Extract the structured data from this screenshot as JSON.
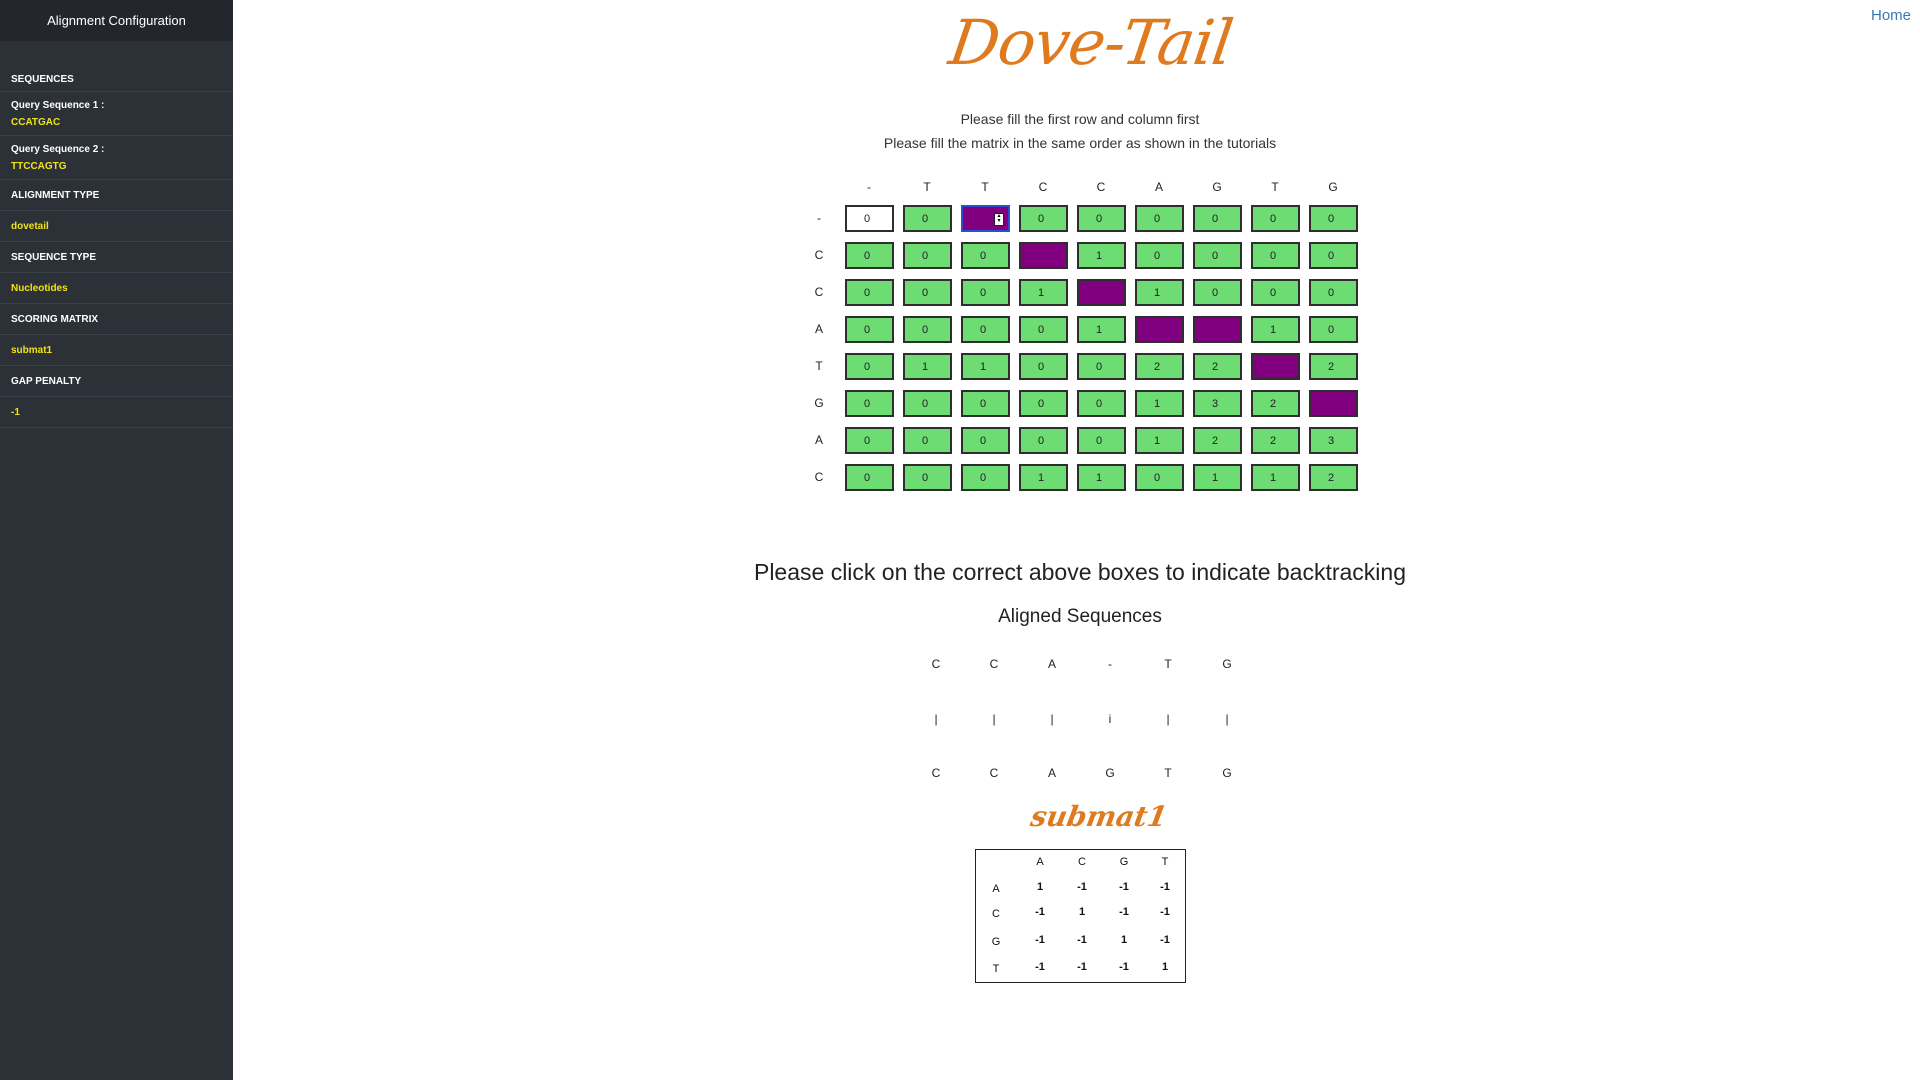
{
  "sidebar": {
    "title": "Alignment Configuration",
    "sections": {
      "sequences": "SEQUENCES",
      "query1_label": "Query Sequence 1 :",
      "query1_value": "CCATGAC",
      "query2_label": "Query Sequence 2 :",
      "query2_value": "TTCCAGTG",
      "alignment_type": "ALIGNMENT TYPE",
      "alignment_type_value": "dovetail",
      "sequence_type": "SEQUENCE TYPE",
      "sequence_type_value": "Nucleotides",
      "scoring_matrix": "SCORING MATRIX",
      "scoring_matrix_value": "submat1",
      "gap_penalty": "GAP PENALTY",
      "gap_penalty_value": "-1"
    }
  },
  "header": {
    "home": "Home",
    "logo": "Dove-Tail"
  },
  "instructions": {
    "line1": "Please fill the first row and column first",
    "line2": "Please fill the matrix in the same order as shown in the tutorials"
  },
  "matrix": {
    "col_headers": [
      "-",
      "T",
      "T",
      "C",
      "C",
      "A",
      "G",
      "T",
      "G"
    ],
    "row_headers": [
      "-",
      "C",
      "C",
      "A",
      "T",
      "G",
      "A",
      "C"
    ],
    "rows": [
      [
        "0",
        "0",
        "",
        "0",
        "0",
        "0",
        "0",
        "0",
        "0"
      ],
      [
        "0",
        "0",
        "0",
        "",
        "1",
        "0",
        "0",
        "0",
        "0"
      ],
      [
        "0",
        "0",
        "0",
        "1",
        "",
        "1",
        "0",
        "0",
        "0"
      ],
      [
        "0",
        "0",
        "0",
        "0",
        "1",
        "",
        "",
        "1",
        "0"
      ],
      [
        "0",
        "1",
        "1",
        "0",
        "0",
        "2",
        "2",
        "",
        "2"
      ],
      [
        "0",
        "0",
        "0",
        "0",
        "0",
        "1",
        "3",
        "2",
        ""
      ],
      [
        "0",
        "0",
        "0",
        "0",
        "0",
        "1",
        "2",
        "2",
        "3"
      ],
      [
        "0",
        "0",
        "0",
        "1",
        "1",
        "0",
        "1",
        "1",
        "2"
      ]
    ],
    "purple_cells": [
      [
        0,
        2
      ],
      [
        1,
        3
      ],
      [
        2,
        4
      ],
      [
        3,
        5
      ],
      [
        3,
        6
      ],
      [
        4,
        7
      ],
      [
        5,
        8
      ]
    ],
    "colors": {
      "filled": "#6cdc73",
      "backtrack": "#800080",
      "empty": "#ffffff"
    }
  },
  "backtrack_prompt": "Please click on the correct above boxes to indicate backtracking",
  "aligned": {
    "title": "Aligned Sequences",
    "top": [
      "C",
      "C",
      "A",
      "-",
      "T",
      "G"
    ],
    "mid": [
      "|",
      "|",
      "|",
      "i",
      "|",
      "|"
    ],
    "bottom": [
      "C",
      "C",
      "A",
      "G",
      "T",
      "G"
    ]
  },
  "submat": {
    "title": "submat1",
    "cols": [
      "A",
      "C",
      "G",
      "T"
    ],
    "rows": [
      {
        "label": "A",
        "values": [
          "1",
          "-1",
          "-1",
          "-1"
        ]
      },
      {
        "label": "C",
        "values": [
          "-1",
          "1",
          "-1",
          "-1"
        ]
      },
      {
        "label": "G",
        "values": [
          "-1",
          "-1",
          "1",
          "-1"
        ]
      },
      {
        "label": "T",
        "values": [
          "-1",
          "-1",
          "-1",
          "1"
        ]
      }
    ]
  }
}
